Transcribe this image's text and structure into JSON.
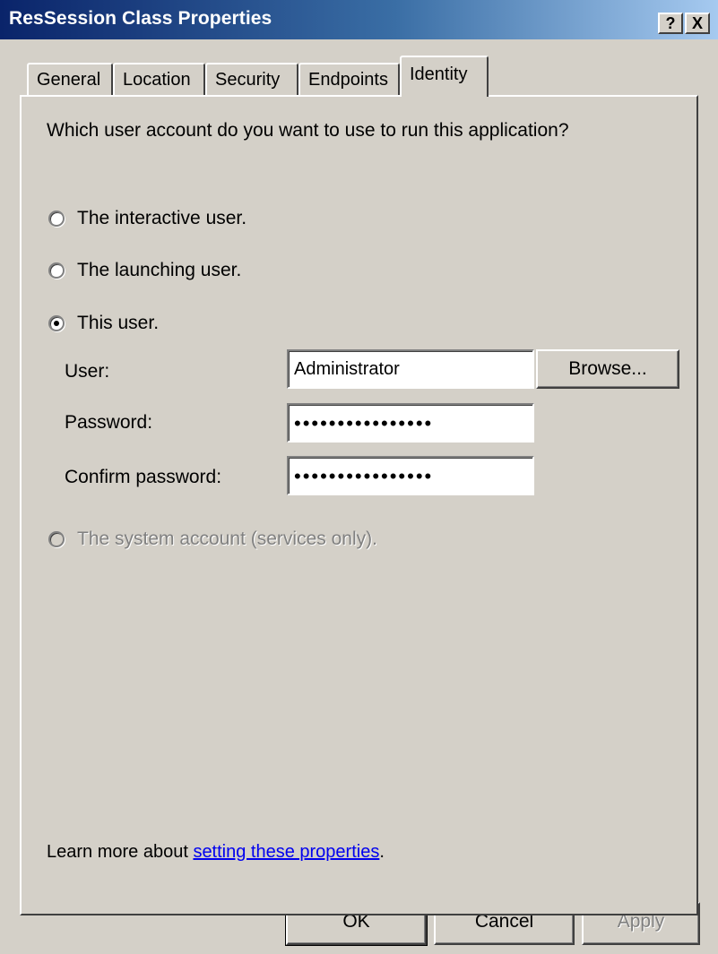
{
  "window": {
    "title": "ResSession Class Properties",
    "help_label": "?",
    "close_label": "X"
  },
  "tabs": [
    {
      "label": "General",
      "active": false
    },
    {
      "label": "Location",
      "active": false
    },
    {
      "label": "Security",
      "active": false
    },
    {
      "label": "Endpoints",
      "active": false
    },
    {
      "label": "Identity",
      "active": true
    }
  ],
  "identity": {
    "question": "Which user account do you want to use to run this application?",
    "options": [
      {
        "label": "The interactive user.",
        "checked": false,
        "enabled": true
      },
      {
        "label": "The launching user.",
        "checked": false,
        "enabled": true
      },
      {
        "label": "This user.",
        "checked": true,
        "enabled": true
      },
      {
        "label": "The system account (services only).",
        "checked": false,
        "enabled": false
      }
    ],
    "user_label": "User:",
    "user_value": "Administrator",
    "browse_label": "Browse...",
    "password_label": "Password:",
    "password_value": "••••••••••••••••",
    "confirm_label": "Confirm password:",
    "confirm_value": "••••••••••••••••",
    "learn_prefix": "Learn more about ",
    "learn_link": "setting these properties",
    "learn_suffix": "."
  },
  "buttons": {
    "ok": "OK",
    "cancel": "Cancel",
    "apply": "Apply",
    "apply_enabled": false
  }
}
